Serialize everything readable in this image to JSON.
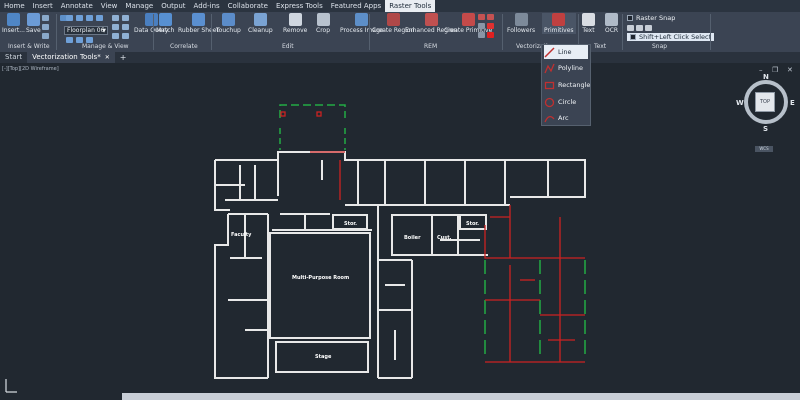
{
  "menu": [
    "Home",
    "Insert",
    "Annotate",
    "View",
    "Manage",
    "Output",
    "Add-ins",
    "Collaborate",
    "Express Tools",
    "Featured Apps",
    "Raster Tools"
  ],
  "ribbon": {
    "groups": {
      "insert_write": "Insert & Write",
      "manage_view": "Manage & View",
      "correlate": "Correlate",
      "edit": "Edit",
      "rem": "REM",
      "vectorization": "Vectorization",
      "text": "Text",
      "snap": "Snap"
    },
    "buttons": {
      "insert": "Insert...",
      "save": "Save",
      "data_query": "Data Query",
      "match": "Match",
      "rubber_sheet": "Rubber Sheet",
      "touchup": "Touchup",
      "cleanup": "Cleanup",
      "remove": "Remove",
      "crop": "Crop",
      "process_image": "Process Image",
      "create_region": "Create Region",
      "enhanced_region": "Enhanced Region",
      "create_primitive": "Create Primitive",
      "followers": "Followers",
      "primitives": "Primitives",
      "text": "Text",
      "ocr": "OCR"
    },
    "dropdown_value": "Floorplan 06",
    "snap": {
      "raster_snap": "Raster Snap",
      "shift_click": "Shift+Left Click Select"
    }
  },
  "tabs": [
    {
      "label": "Start"
    },
    {
      "label": "Vectorization Tools*"
    }
  ],
  "viewport_label": "[-][Top][2D Wireframe]",
  "primitives_menu": [
    "Line",
    "Polyline",
    "Rectangle",
    "Circle",
    "Arc"
  ],
  "plan_labels": {
    "faculty": "Faculty",
    "stor1": "Stor.",
    "boiler": "Boiler",
    "cust": "Cust.",
    "stor2": "Stor.",
    "multi": "Multi-Purpose Room",
    "stage": "Stage"
  },
  "viewcube": {
    "top": "TOP",
    "n": "N",
    "s": "S",
    "e": "E",
    "w": "W",
    "wcs": "WCS"
  },
  "colors": {
    "accent": "#cc2222",
    "green": "#22aa44",
    "plan": "#e8e8e8"
  }
}
